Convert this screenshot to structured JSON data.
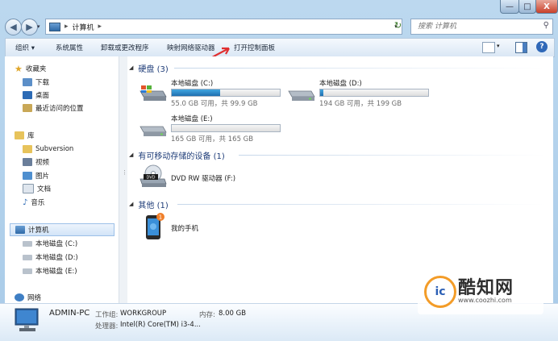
{
  "window": {
    "minimize": "—",
    "maximize": "□",
    "close": "X"
  },
  "address": {
    "location": "计算机",
    "search_placeholder": "搜索 计算机"
  },
  "toolbar": {
    "organize": "组织 ▾",
    "system_properties": "系统属性",
    "uninstall": "卸载或更改程序",
    "map_drive": "映射网络驱动器",
    "open_control_panel": "打开控制面板"
  },
  "nav": {
    "favorites": "收藏夹",
    "downloads": "下载",
    "desktop": "桌面",
    "recent": "最近访问的位置",
    "libraries": "库",
    "subversion": "Subversion",
    "videos": "视频",
    "pictures": "图片",
    "documents": "文档",
    "music": "音乐",
    "computer": "计算机",
    "drive_c": "本地磁盘 (C:)",
    "drive_d": "本地磁盘 (D:)",
    "drive_e": "本地磁盘 (E:)",
    "network": "网络"
  },
  "groups": {
    "hard_disks": "硬盘 (3)",
    "removable": "有可移动存储的设备 (1)",
    "other": "其他 (1)"
  },
  "drives": [
    {
      "name": "本地磁盘 (C:)",
      "size": "55.0 GB 可用，共 99.9 GB",
      "used_fraction": 0.45
    },
    {
      "name": "本地磁盘 (D:)",
      "size": "194 GB 可用，共 199 GB",
      "used_fraction": 0.03
    },
    {
      "name": "本地磁盘 (E:)",
      "size": "165 GB 可用，共 165 GB",
      "used_fraction": 0.0
    }
  ],
  "dvd": {
    "name": "DVD RW 驱动器 (F:)",
    "icon_text": "DVD"
  },
  "phone": {
    "name": "我的手机",
    "badge": "1"
  },
  "details": {
    "pc_name": "ADMIN-PC",
    "workgroup_label": "工作组:",
    "workgroup_value": "WORKGROUP",
    "memory_label": "内存:",
    "memory_value": "8.00 GB",
    "cpu_label": "处理器:",
    "cpu_value": "Intel(R) Core(TM) i3-4..."
  },
  "watermark": {
    "name": "酷知网",
    "url": "www.coozhi.com"
  },
  "colors": {
    "accent": "#1e6eb0",
    "group_text": "#1e3c78",
    "arrow": "#e03030"
  }
}
